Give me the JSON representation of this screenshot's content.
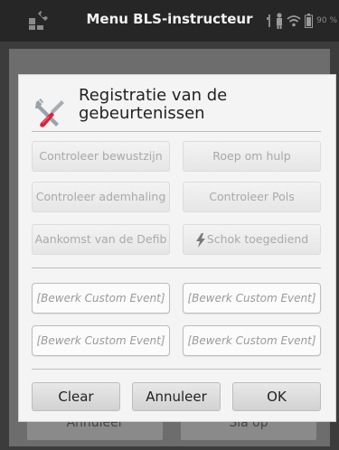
{
  "statusbar": {
    "title": "Menu BLS-instructeur",
    "battery": "90 %"
  },
  "background": {
    "cancel_label": "Annuleer",
    "save_label": "Sla op"
  },
  "dialog": {
    "title": "Registratie van de gebeurtenissen",
    "events": [
      "Controleer bewustzijn",
      "Roep om hulp",
      "Controleer ademhaling",
      "Controleer Pols",
      "Aankomst van de Defib",
      "Schok toegediend"
    ],
    "custom_events": [
      "[Bewerk Custom Event]",
      "[Bewerk Custom Event]",
      "[Bewerk Custom Event]",
      "[Bewerk Custom Event]"
    ],
    "actions": {
      "clear": "Clear",
      "cancel": "Annuleer",
      "ok": "OK"
    }
  },
  "colors": {
    "bolt": "#7a7a7a",
    "tool_handle": "#d8233a"
  }
}
